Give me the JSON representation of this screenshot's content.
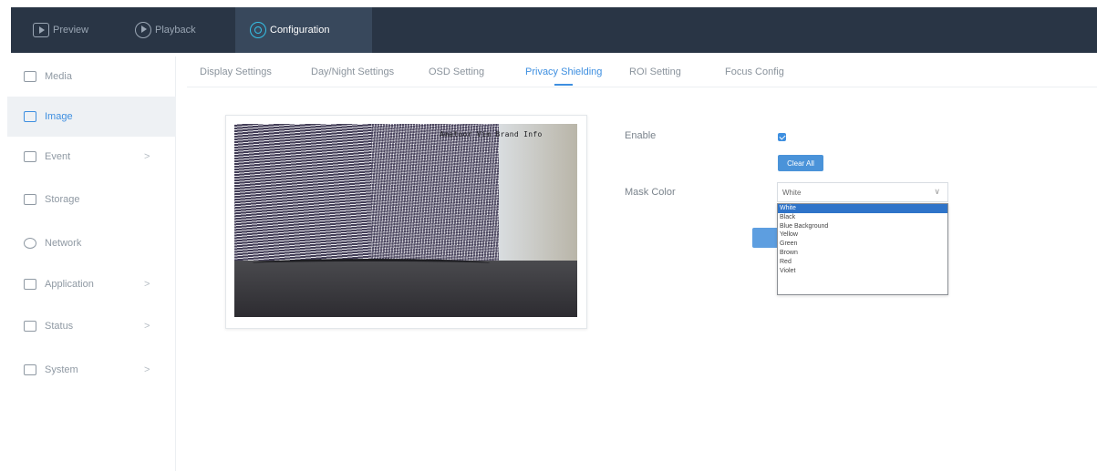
{
  "topnav": {
    "tabs": [
      {
        "label": "Preview",
        "icon": "play-square-icon"
      },
      {
        "label": "Playback",
        "icon": "play-circle-icon"
      },
      {
        "label": "Configuration",
        "icon": "configuration-icon",
        "active": true
      }
    ]
  },
  "sidebar": {
    "items": [
      {
        "label": "Media",
        "icon": "media-icon",
        "has_children": false
      },
      {
        "label": "Image",
        "icon": "image-icon",
        "active": true,
        "has_children": false
      },
      {
        "label": "Event",
        "icon": "event-icon",
        "has_children": true
      },
      {
        "label": "Storage",
        "icon": "storage-icon",
        "has_children": false
      },
      {
        "label": "Network",
        "icon": "network-icon",
        "has_children": false
      },
      {
        "label": "Application",
        "icon": "application-icon",
        "has_children": true
      },
      {
        "label": "Status",
        "icon": "status-icon",
        "has_children": true
      },
      {
        "label": "System",
        "icon": "system-icon",
        "has_children": true
      }
    ],
    "chevron": ">"
  },
  "subtabs": [
    {
      "label": "Display Settings"
    },
    {
      "label": "Day/Night Settings"
    },
    {
      "label": "OSD Setting"
    },
    {
      "label": "Privacy Shielding",
      "active": true
    },
    {
      "label": "ROI Setting"
    },
    {
      "label": "Focus Config"
    }
  ],
  "video": {
    "osd_text": "Amatoor Vim Brand Info"
  },
  "privacy": {
    "enable_label": "Enable",
    "enable_checked": true,
    "clear_all_label": "Clear All",
    "mask_color_label": "Mask Color",
    "mask_color_value": "White",
    "mask_color_options": [
      "White",
      "Black",
      "Blue Background",
      "Yellow",
      "Green",
      "Brown",
      "Red",
      "Violet"
    ],
    "selected_option": "White"
  },
  "colors": {
    "topbar_bg": "#293545",
    "accent": "#3e8fe0",
    "selected_option_bg": "#2f74c9"
  }
}
